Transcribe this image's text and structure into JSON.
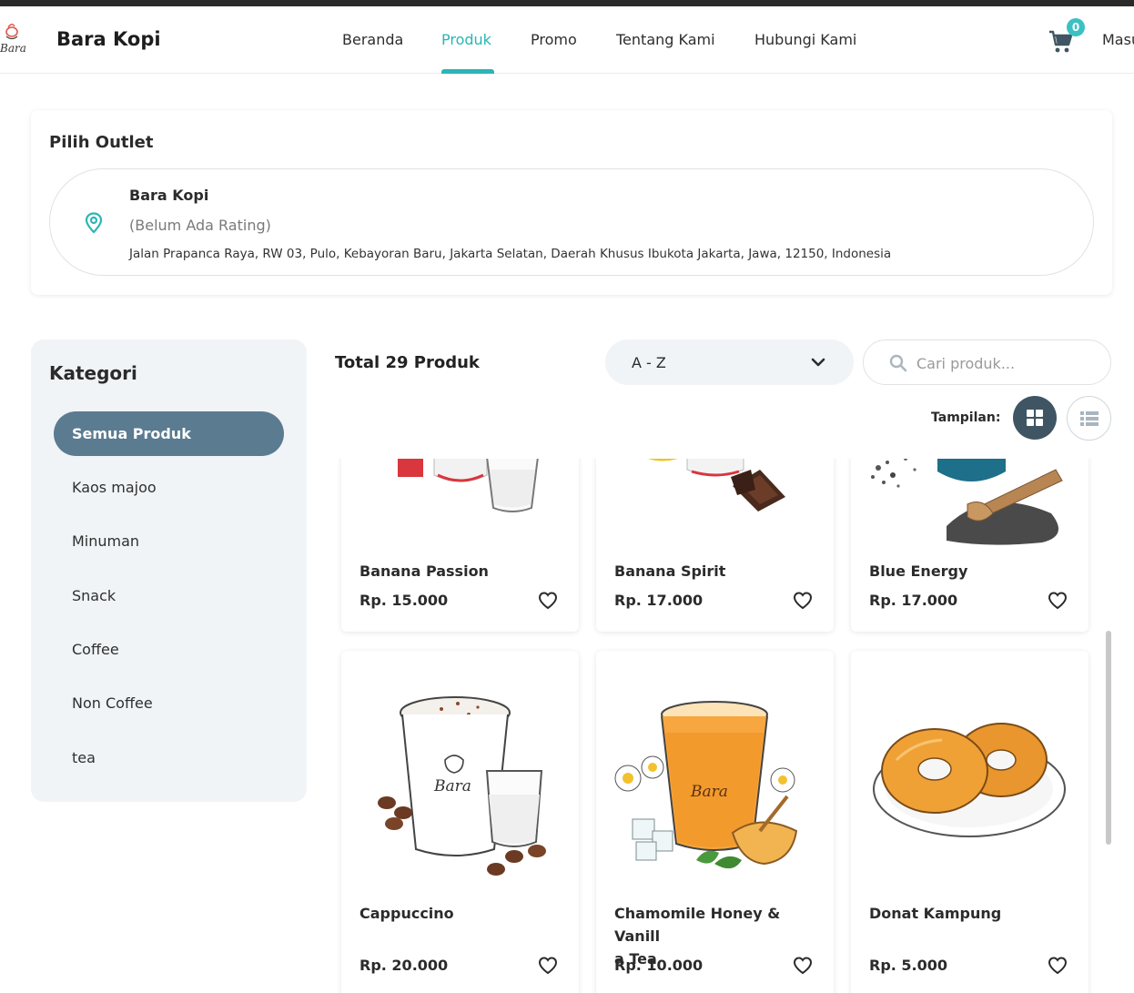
{
  "header": {
    "brand": "Bara Kopi",
    "logo_text": "Bara",
    "nav": [
      "Beranda",
      "Produk",
      "Promo",
      "Tentang Kami",
      "Hubungi Kami"
    ],
    "active_nav": "Produk",
    "cart_count": "0",
    "login_label": "Masuk"
  },
  "outlet": {
    "section_title": "Pilih Outlet",
    "name": "Bara Kopi",
    "rating": "(Belum Ada Rating)",
    "address": "Jalan Prapanca Raya, RW 03, Pulo, Kebayoran Baru, Jakarta Selatan, Daerah Khusus Ibukota Jakarta, Jawa, 12150, Indonesia"
  },
  "kategori": {
    "title": "Kategori",
    "items": [
      "Semua Produk",
      "Kaos majoo",
      "Minuman",
      "Snack",
      "Coffee",
      "Non Coffee",
      "tea"
    ],
    "active": "Semua Produk"
  },
  "toolbar": {
    "total_label": "Total 29 Produk",
    "sort_value": "A - Z",
    "search_placeholder": "Cari produk...",
    "view_label": "Tampilan:",
    "view_mode": "grid"
  },
  "products": [
    {
      "name": "Banana Passion",
      "price": "Rp. 15.000",
      "image": "milk-glass-red-cup"
    },
    {
      "name": "Banana Spirit",
      "price": "Rp. 17.000",
      "image": "chocolate-pieces"
    },
    {
      "name": "Blue Energy",
      "price": "Rp. 17.000",
      "image": "chia-seeds-scoop"
    },
    {
      "name": "Cappuccino",
      "price": "Rp. 20.000",
      "image": "cappuccino-cup",
      "cup_label": "Bara"
    },
    {
      "name": "Chamomile Honey & Vanilla Tea",
      "name_lines": [
        "Chamomile Honey & Vanill",
        "a Tea"
      ],
      "price": "Rp. 10.000",
      "image": "iced-tea-honey",
      "cup_label": "Bara"
    },
    {
      "name": "Donat Kampung",
      "price": "Rp. 5.000",
      "image": "donuts-plate"
    }
  ],
  "colors": {
    "accent": "#2cb5b5",
    "category_active": "#5b7b91",
    "view_active": "#3f5563",
    "panel_bg": "#f1f4f7"
  }
}
